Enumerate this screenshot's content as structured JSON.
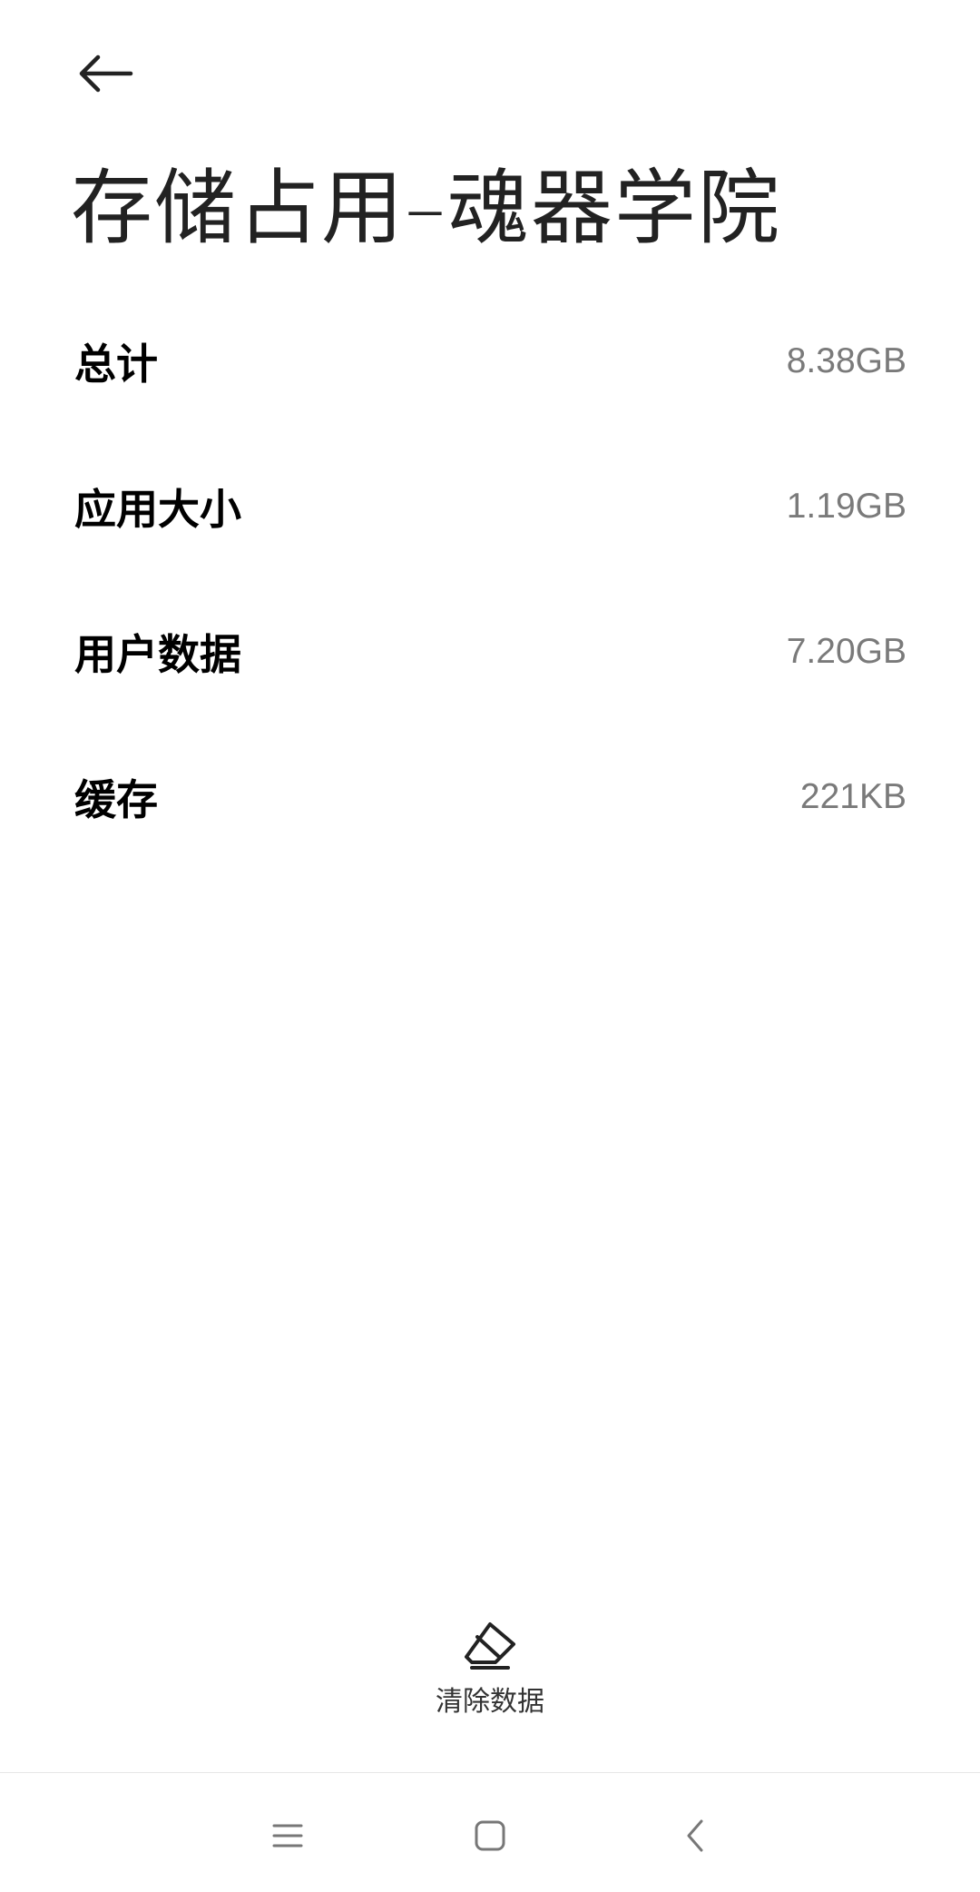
{
  "header": {
    "back_icon": "arrow-left-icon",
    "title": "存储占用–魂器学院"
  },
  "storage": {
    "rows": [
      {
        "label": "总计",
        "value": "8.38GB"
      },
      {
        "label": "应用大小",
        "value": "1.19GB"
      },
      {
        "label": "用户数据",
        "value": "7.20GB"
      },
      {
        "label": "缓存",
        "value": "221KB"
      }
    ]
  },
  "actions": {
    "clear_data_icon": "eraser-icon",
    "clear_data_label": "清除数据"
  },
  "navbar": {
    "recents_icon": "menu-icon",
    "home_icon": "square-icon",
    "back_icon": "chevron-left-icon"
  }
}
